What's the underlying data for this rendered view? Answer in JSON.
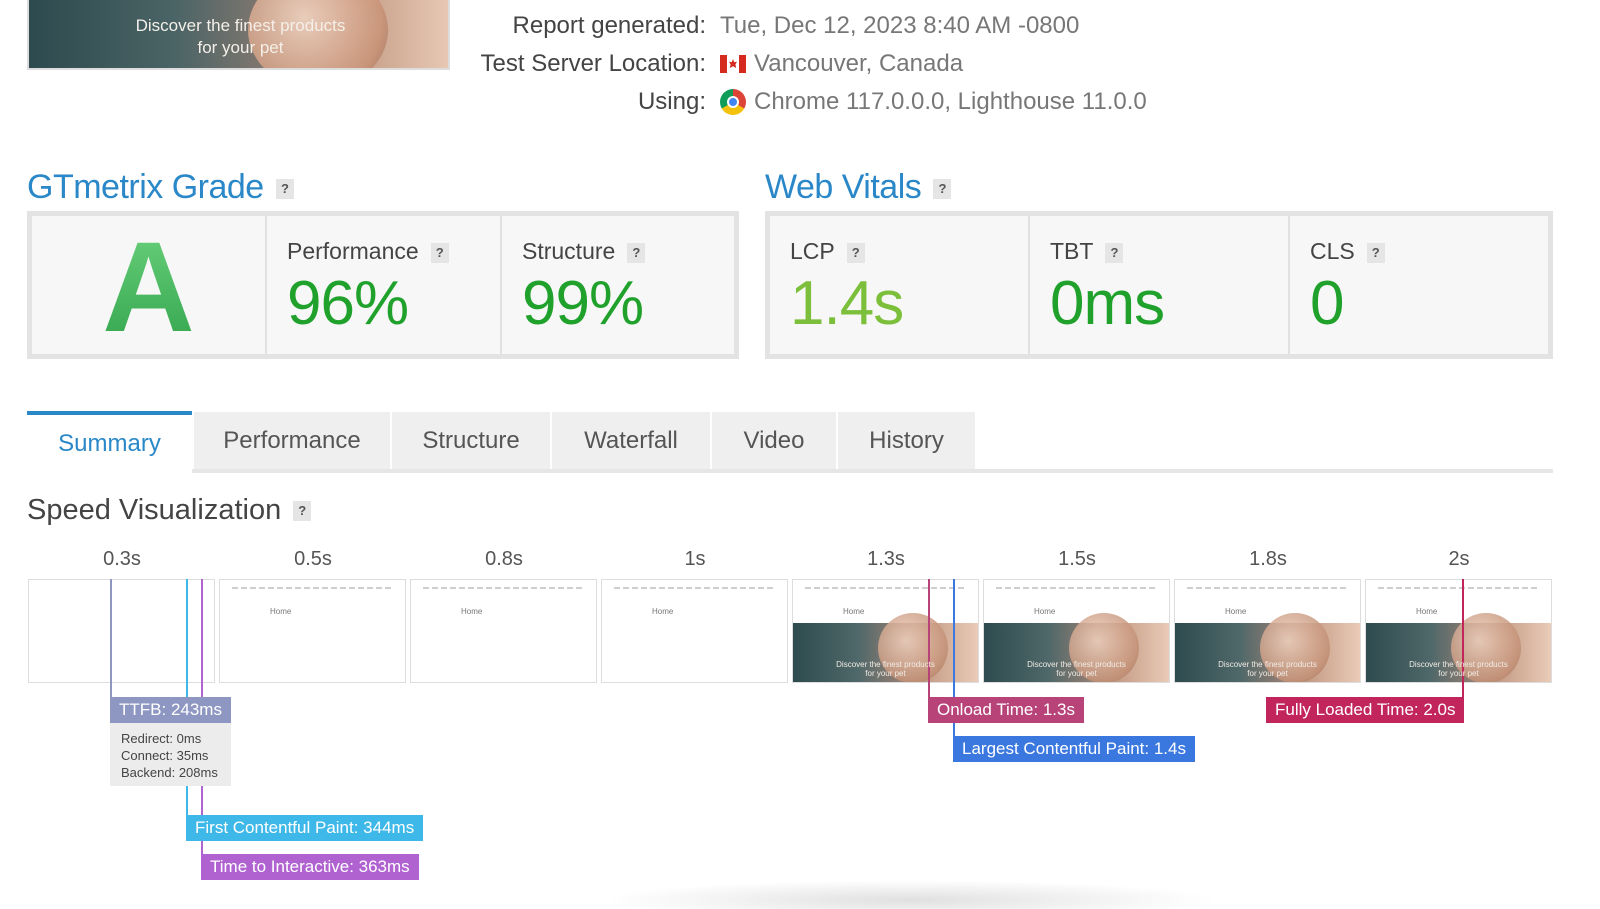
{
  "hero": {
    "line1": "Discover the finest products",
    "line2": "for your pet"
  },
  "report": {
    "generated_label": "Report generated:",
    "generated_value": "Tue, Dec 12, 2023 8:40 AM -0800",
    "location_label": "Test Server Location:",
    "location_value": "Vancouver, Canada",
    "using_label": "Using:",
    "using_value": "Chrome 117.0.0.0, Lighthouse 11.0.0"
  },
  "grade": {
    "title": "GTmetrix Grade",
    "letter": "A",
    "performance_label": "Performance",
    "performance_value": "96%",
    "structure_label": "Structure",
    "structure_value": "99%"
  },
  "vitals": {
    "title": "Web Vitals",
    "lcp_label": "LCP",
    "lcp_value": "1.4s",
    "tbt_label": "TBT",
    "tbt_value": "0ms",
    "cls_label": "CLS",
    "cls_value": "0"
  },
  "help_glyph": "?",
  "tabs": [
    {
      "label": "Summary",
      "active": true
    },
    {
      "label": "Performance",
      "active": false
    },
    {
      "label": "Structure",
      "active": false
    },
    {
      "label": "Waterfall",
      "active": false
    },
    {
      "label": "Video",
      "active": false
    },
    {
      "label": "History",
      "active": false
    }
  ],
  "speed": {
    "title": "Speed Visualization",
    "ticks": [
      "0.3s",
      "0.5s",
      "0.8s",
      "1s",
      "1.3s",
      "1.5s",
      "1.8s",
      "2s"
    ],
    "frame_home": "Home",
    "frame_caption1": "Discover the finest products",
    "frame_caption2": "for your pet",
    "markers": {
      "ttfb": "TTFB: 243ms",
      "ttfb_redirect": "Redirect: 0ms",
      "ttfb_connect": "Connect: 35ms",
      "ttfb_backend": "Backend: 208ms",
      "fcp": "First Contentful Paint: 344ms",
      "tti": "Time to Interactive: 363ms",
      "onload": "Onload Time: 1.3s",
      "lcp": "Largest Contentful Paint: 1.4s",
      "fully_loaded": "Fully Loaded Time: 2.0s"
    }
  },
  "colors": {
    "accent": "#2a88c8",
    "grade_green": "#42b25a",
    "perf_green": "#1fa12b",
    "lcp_green": "#7cbf3b",
    "ttfb": "#8e97c2",
    "fcp": "#3db8e8",
    "tti": "#b062d1",
    "onload": "#b84379",
    "lcp_marker": "#3a78e0",
    "fully_loaded": "#c2255c"
  }
}
